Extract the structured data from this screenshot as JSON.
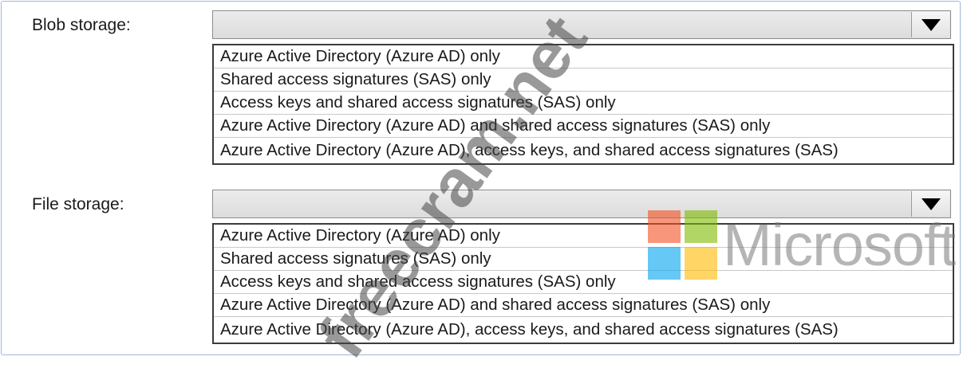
{
  "blob": {
    "label": "Blob storage:",
    "selected": "",
    "options": [
      "Azure Active Directory (Azure AD) only",
      "Shared access signatures (SAS) only",
      "Access keys and shared access signatures (SAS) only",
      "Azure Active Directory (Azure AD) and shared access signatures (SAS) only",
      "Azure Active Directory (Azure AD), access keys, and shared access signatures (SAS)"
    ]
  },
  "file": {
    "label": "File storage:",
    "selected": "",
    "options": [
      "Azure Active Directory (Azure AD) only",
      "Shared access signatures (SAS) only",
      "Access keys and shared access signatures (SAS) only",
      "Azure Active Directory (Azure AD) and shared access signatures (SAS) only",
      "Azure Active Directory (Azure AD), access keys, and shared access signatures (SAS)"
    ]
  },
  "branding": {
    "microsoft_wordmark": "Microsoft",
    "logo_colors": [
      "#f25022",
      "#7fba00",
      "#00a4ef",
      "#ffb900"
    ],
    "watermark": "freecram.net"
  },
  "icons": {
    "dropdown": "triangle-down-icon"
  }
}
